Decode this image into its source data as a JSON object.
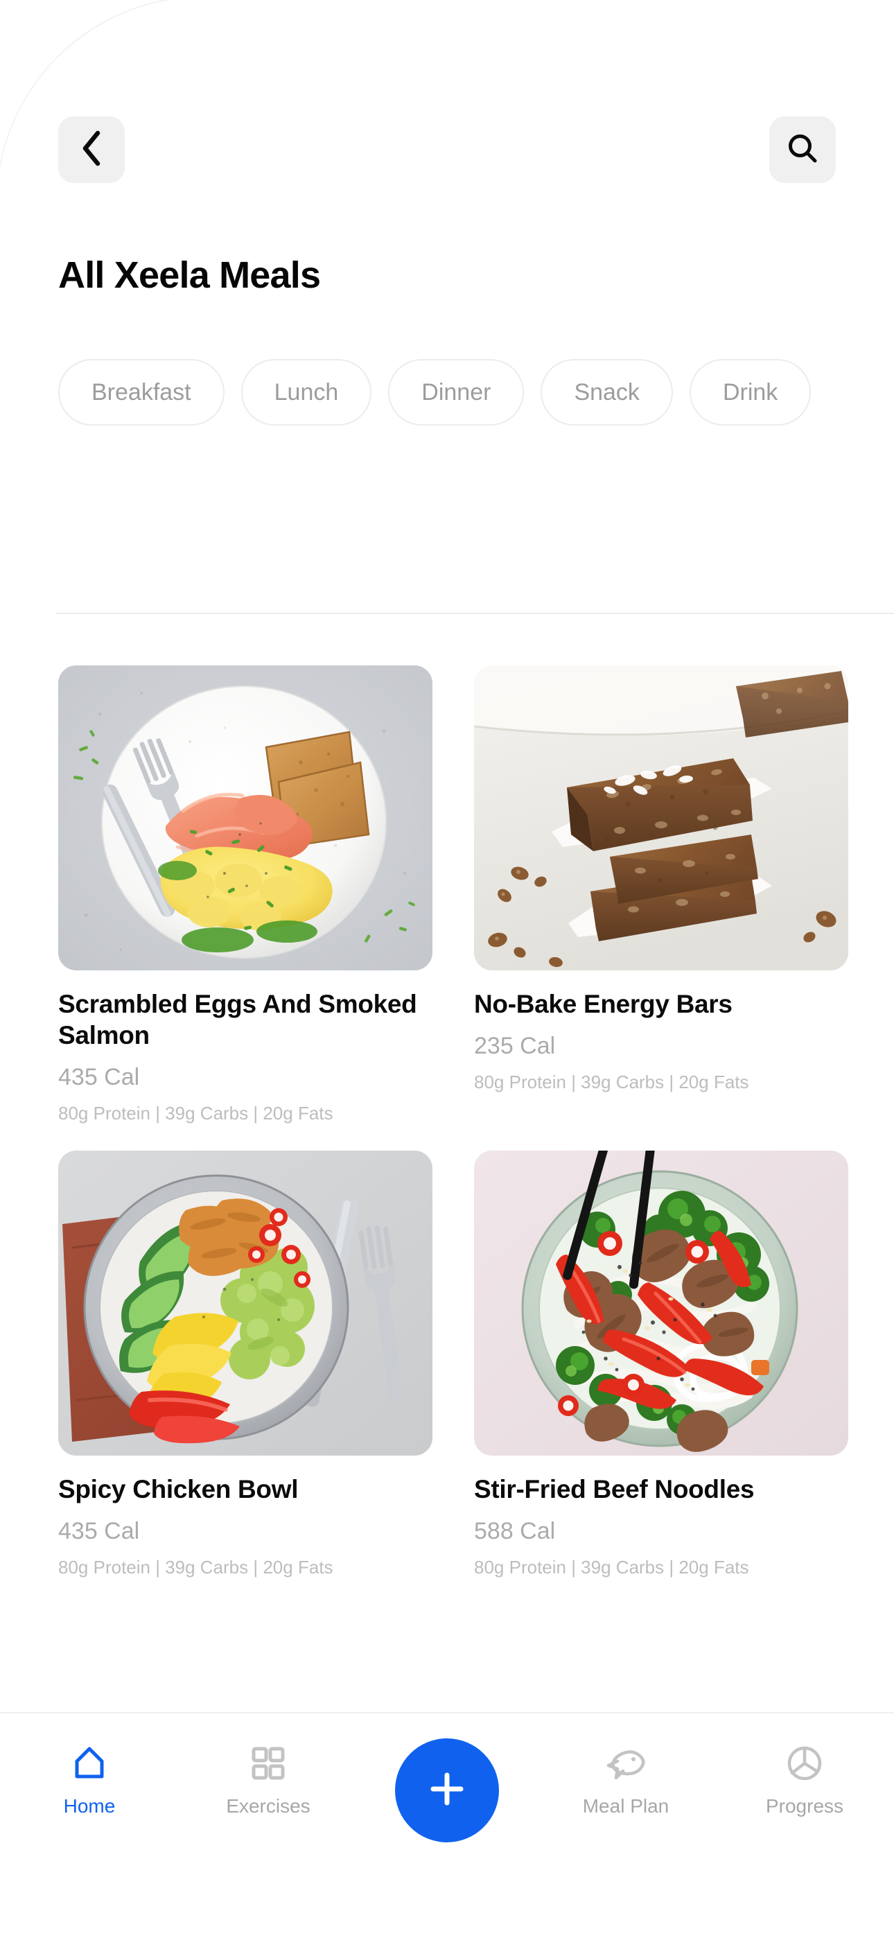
{
  "header": {
    "back_icon": "chevron-left-icon",
    "search_icon": "search-icon",
    "title": "All Xeela Meals"
  },
  "filters": {
    "chips": [
      {
        "label": "Breakfast",
        "selected": false
      },
      {
        "label": "Lunch",
        "selected": false
      },
      {
        "label": "Dinner",
        "selected": false
      },
      {
        "label": "Snack",
        "selected": false
      },
      {
        "label": "Drink",
        "selected": false
      }
    ]
  },
  "meals": [
    {
      "title": "Scrambled Eggs And Smoked Salmon",
      "calories": "435 Cal",
      "macros": "80g Protein | 39g Carbs | 20g Fats",
      "image": "scrambled-eggs-salmon-photo"
    },
    {
      "title": "No-Bake Energy Bars",
      "calories": "235 Cal",
      "macros": "80g Protein | 39g Carbs | 20g Fats",
      "image": "energy-bars-photo"
    },
    {
      "title": "Spicy Chicken Bowl",
      "calories": "435 Cal",
      "macros": "80g Protein | 39g Carbs | 20g Fats",
      "image": "spicy-chicken-bowl-photo"
    },
    {
      "title": "Stir-Fried Beef Noodles",
      "calories": "588 Cal",
      "macros": "80g Protein | 39g Carbs | 20g Fats",
      "image": "stir-fried-beef-noodles-photo"
    }
  ],
  "bottom_nav": {
    "items": [
      {
        "label": "Home",
        "icon": "home-icon",
        "active": true
      },
      {
        "label": "Exercises",
        "icon": "grid-squares-icon",
        "active": false
      },
      {
        "label": "",
        "icon": "plus-icon",
        "active": false
      },
      {
        "label": "Meal Plan",
        "icon": "fish-icon",
        "active": false
      },
      {
        "label": "Progress",
        "icon": "pie-chart-icon",
        "active": false
      }
    ],
    "add_button_icon": "plus-icon"
  },
  "colors": {
    "accent": "#1062ee",
    "text_primary": "#0b0b0b",
    "text_muted": "#ababab",
    "text_faint": "#bdbdbd",
    "chip_border": "#ececec",
    "icon_button_bg": "#f0f0f0"
  }
}
